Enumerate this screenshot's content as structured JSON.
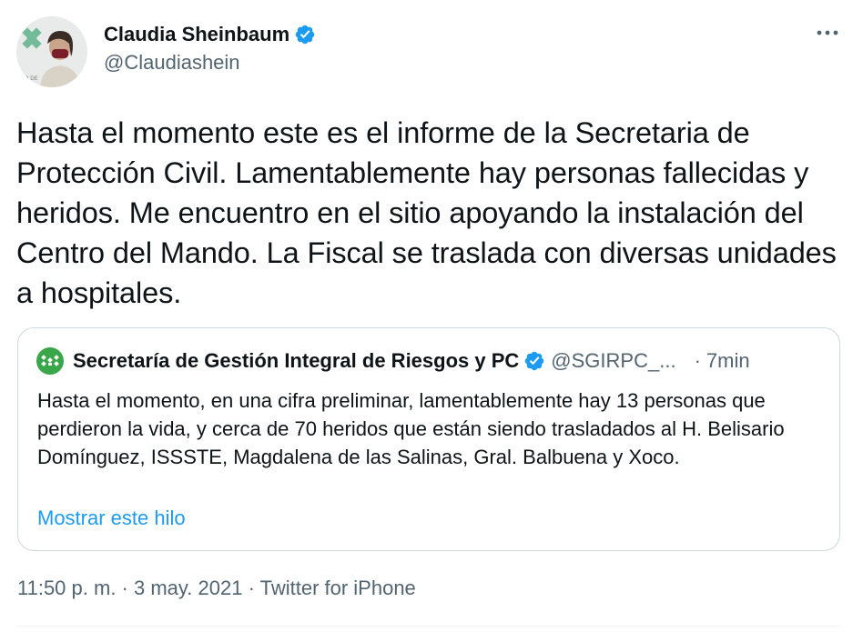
{
  "author": {
    "display_name": "Claudia Sheinbaum",
    "handle": "@Claudiashein",
    "verified": true,
    "avatar_icon": "profile-photo"
  },
  "more_icon": "more-options-icon",
  "tweet": {
    "text": "Hasta el momento este es el informe de la Secretaria de Protección Civil. Lamentablemente hay personas fallecidas y heridos. Me encuentro en el sitio apoyando la instalación del Centro del Mando. La Fiscal se traslada con diversas unidades a hospitales."
  },
  "quote": {
    "avatar_icon": "sgirpc-logo",
    "display_name": "Secretaría de Gestión Integral de Riesgos y PC",
    "verified": true,
    "handle": "@SGIRPC_...",
    "separator": "·",
    "time": "7min",
    "text": "Hasta el momento, en una cifra preliminar, lamentablemente hay 13 personas que perdieron la vida, y cerca de 70 heridos que están siendo trasladados al H. Belisario Domínguez, ISSSTE, Magdalena de las Salinas, Gral. Balbuena y Xoco.",
    "show_thread": "Mostrar este hilo"
  },
  "meta": {
    "time": "11:50 p. m.",
    "sep1": " · ",
    "date": "3 may. 2021",
    "sep2": " · ",
    "source": "Twitter for iPhone"
  },
  "colors": {
    "verified": "#1d9bf0",
    "link": "#1d9bf0",
    "secondary_text": "#536471",
    "border": "#cfd9de",
    "cdmx_green": "#3aa64a"
  }
}
